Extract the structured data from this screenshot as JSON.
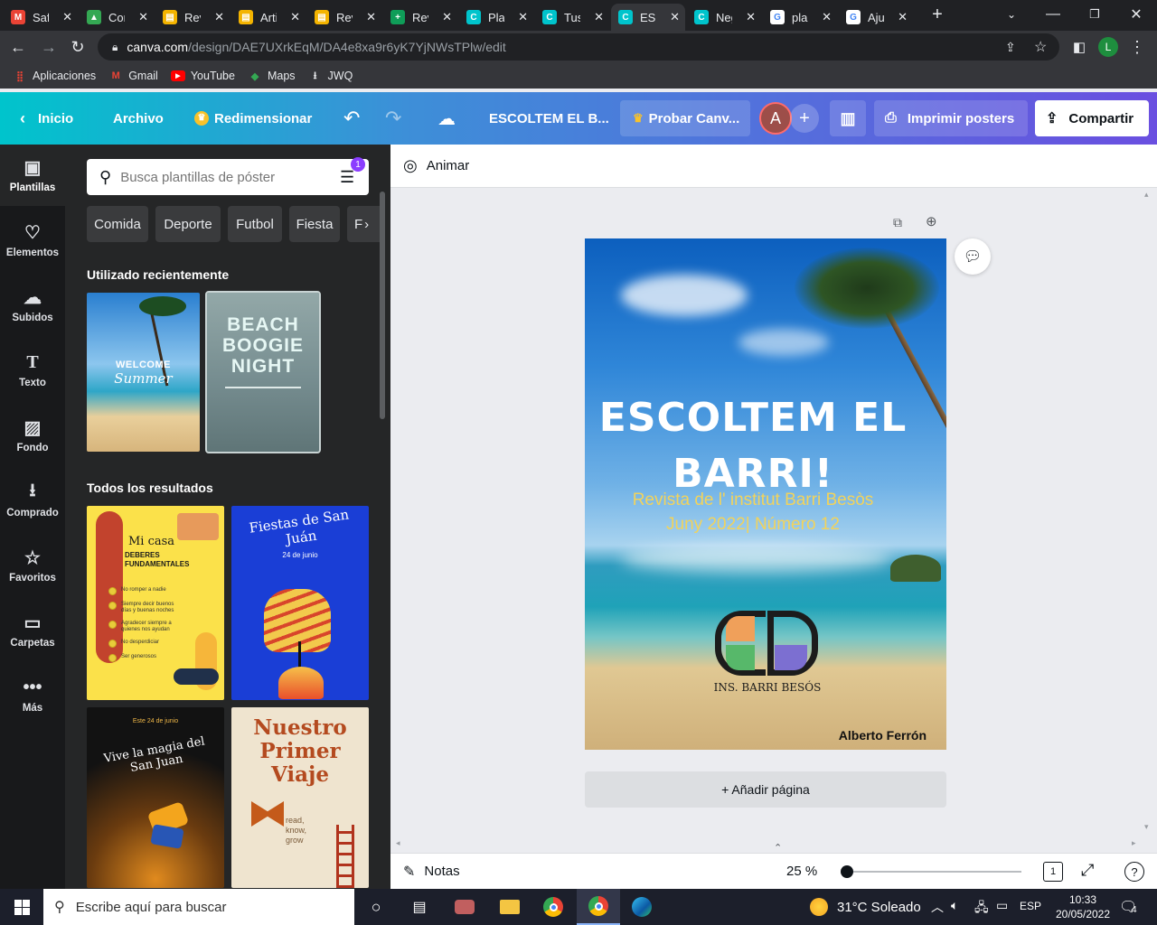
{
  "browser": {
    "tabs": [
      {
        "title": "Safari",
        "fav_color": "#ea4335",
        "fav_glyph": "M"
      },
      {
        "title": "Cor",
        "fav_color": "#34a853",
        "fav_glyph": "▲"
      },
      {
        "title": "Rev",
        "fav_color": "#f4b400",
        "fav_glyph": "▤"
      },
      {
        "title": "Arti",
        "fav_color": "#f4b400",
        "fav_glyph": "▤"
      },
      {
        "title": "Rev",
        "fav_color": "#f4b400",
        "fav_glyph": "▤"
      },
      {
        "title": "Rev",
        "fav_color": "#0f9d58",
        "fav_glyph": "+"
      },
      {
        "title": "Plan",
        "fav_color": "#00c4cc",
        "fav_glyph": "C"
      },
      {
        "title": "Tus",
        "fav_color": "#00c4cc",
        "fav_glyph": "C"
      },
      {
        "title": "ESC",
        "fav_color": "#00c4cc",
        "fav_glyph": "C"
      },
      {
        "title": "Neg",
        "fav_color": "#00c4cc",
        "fav_glyph": "C"
      },
      {
        "title": "plan",
        "fav_color": "#ffffff",
        "fav_glyph": "G"
      },
      {
        "title": "Aju",
        "fav_color": "#ffffff",
        "fav_glyph": "G"
      }
    ],
    "active_tab_index": 8,
    "url_host": "canva.com",
    "url_path": "/design/DAE7UXrkEqM/DA4e8xa9r6yK7YjNWsTPlw/edit",
    "profile_initial": "L",
    "bookmarks": [
      {
        "label": "Aplicaciones",
        "icon": "apps-grid-icon"
      },
      {
        "label": "Gmail",
        "icon": "gmail-icon"
      },
      {
        "label": "YouTube",
        "icon": "youtube-icon"
      },
      {
        "label": "Maps",
        "icon": "maps-icon"
      },
      {
        "label": "JWQ",
        "icon": "download-icon"
      }
    ]
  },
  "header": {
    "home": "Inicio",
    "file": "Archivo",
    "resize": "Redimensionar",
    "doc_title": "ESCOLTEM EL B...",
    "try_pro": "Probar Canv...",
    "avatar_initial": "A",
    "print": "Imprimir posters",
    "share": "Compartir"
  },
  "rail": [
    {
      "label": "Plantillas",
      "icon": "templates-icon"
    },
    {
      "label": "Elementos",
      "icon": "elements-icon"
    },
    {
      "label": "Subidos",
      "icon": "uploads-icon"
    },
    {
      "label": "Texto",
      "icon": "text-icon"
    },
    {
      "label": "Fondo",
      "icon": "background-icon"
    },
    {
      "label": "Comprado",
      "icon": "purchased-icon"
    },
    {
      "label": "Favoritos",
      "icon": "star-icon"
    },
    {
      "label": "Carpetas",
      "icon": "folder-icon"
    },
    {
      "label": "Más",
      "icon": "more-icon"
    }
  ],
  "panel": {
    "search_placeholder": "Busca plantillas de póster",
    "filter_badge": "1",
    "chips": [
      "Comida",
      "Deporte",
      "Futbol",
      "Fiesta",
      "F"
    ],
    "recent_title": "Utilizado recientemente",
    "recent": [
      {
        "line1": "WELCOME",
        "line2": "Summer"
      },
      {
        "line1": "BEACH",
        "line2": "BOOGIE",
        "line3": "NIGHT"
      }
    ],
    "results_title": "Todos los resultados",
    "results": [
      {
        "title1": "Mi casa",
        "title2": "DEBERES FUNDAMENTALES",
        "items": [
          "No romper a nadie",
          "Siempre decir buenos días y buenas noches",
          "Agradecer siempre a quienes nos ayudan",
          "No desperdiciar",
          "Ser generosos"
        ]
      },
      {
        "title": "Fiestas de San Juán",
        "sub": "24 de junio"
      },
      {
        "date": "Este 24 de junio",
        "title": "Vive la magia del San Juan"
      },
      {
        "title1": "Nuestro",
        "title2": "Primer",
        "title3": "Viaje",
        "words": [
          "read,",
          "know,",
          "grow"
        ]
      }
    ]
  },
  "workspace": {
    "animate": "Animar",
    "add_page": "+ Añadir página",
    "notes": "Notas",
    "zoom": "25 %",
    "zoom_fraction": 0.0,
    "page_count": "1"
  },
  "poster": {
    "title_line1": "ESCOLTEM EL",
    "title_line2": "BARRI!",
    "subtitle_line1": "Revista de l' institut Barri Besòs",
    "subtitle_line2": "Juny 2022| Número 12",
    "logo_text": "INS. BARRI BESÓS",
    "author": "Alberto Ferrón",
    "colors": {
      "title": "#ffffff",
      "subtitle": "#f2d35b",
      "logo_orange": "#f0a05a",
      "logo_green": "#57b86a",
      "logo_purple": "#7c6fd1"
    }
  },
  "taskbar": {
    "search_placeholder": "Escribe aquí para buscar",
    "weather": "31°C  Soleado",
    "lang": "ESP",
    "time": "10:33",
    "date": "20/05/2022",
    "notifications": "4"
  }
}
